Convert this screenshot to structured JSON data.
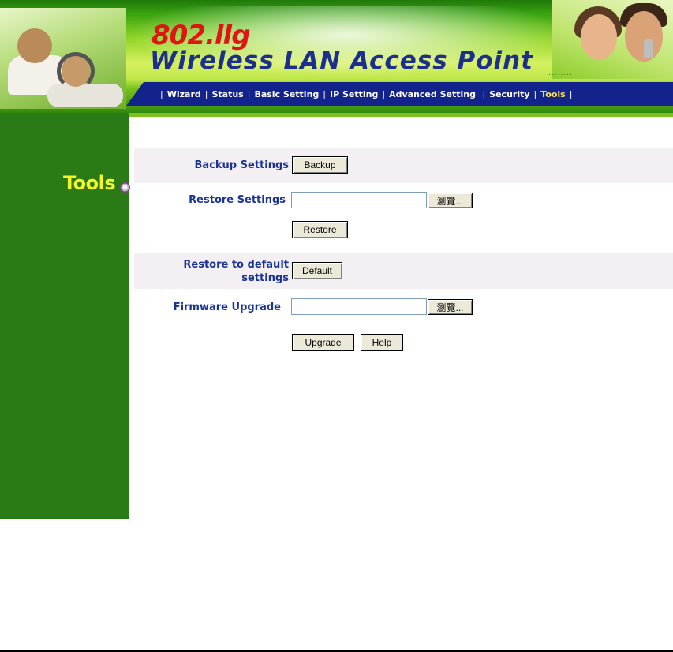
{
  "header": {
    "model": "802.llg",
    "product": "Wireless LAN Access Point",
    "dots": "........"
  },
  "nav": {
    "items": [
      "Wizard",
      "Status",
      "Basic Setting",
      "IP Setting",
      "Advanced Setting",
      "Security",
      "Tools"
    ],
    "active": "Tools"
  },
  "sidebar": {
    "title": "Tools"
  },
  "backup": {
    "label": "Backup Settings",
    "button": "Backup"
  },
  "restore": {
    "label": "Restore Settings",
    "file_value": "",
    "browse_button": "瀏覽...",
    "button": "Restore"
  },
  "default": {
    "label_line1": "Restore to default",
    "label_line2": "settings",
    "button": "Default"
  },
  "firmware": {
    "label": "Firmware Upgrade",
    "file_value": "",
    "browse_button": "瀏覽...",
    "upgrade_button": "Upgrade",
    "help_button": "Help"
  },
  "colors": {
    "sidebar": "#2a7a16",
    "nav_bar": "#12238c",
    "label": "#1a3396",
    "accent_red": "#e01414",
    "active_tab": "#ffe14a"
  }
}
